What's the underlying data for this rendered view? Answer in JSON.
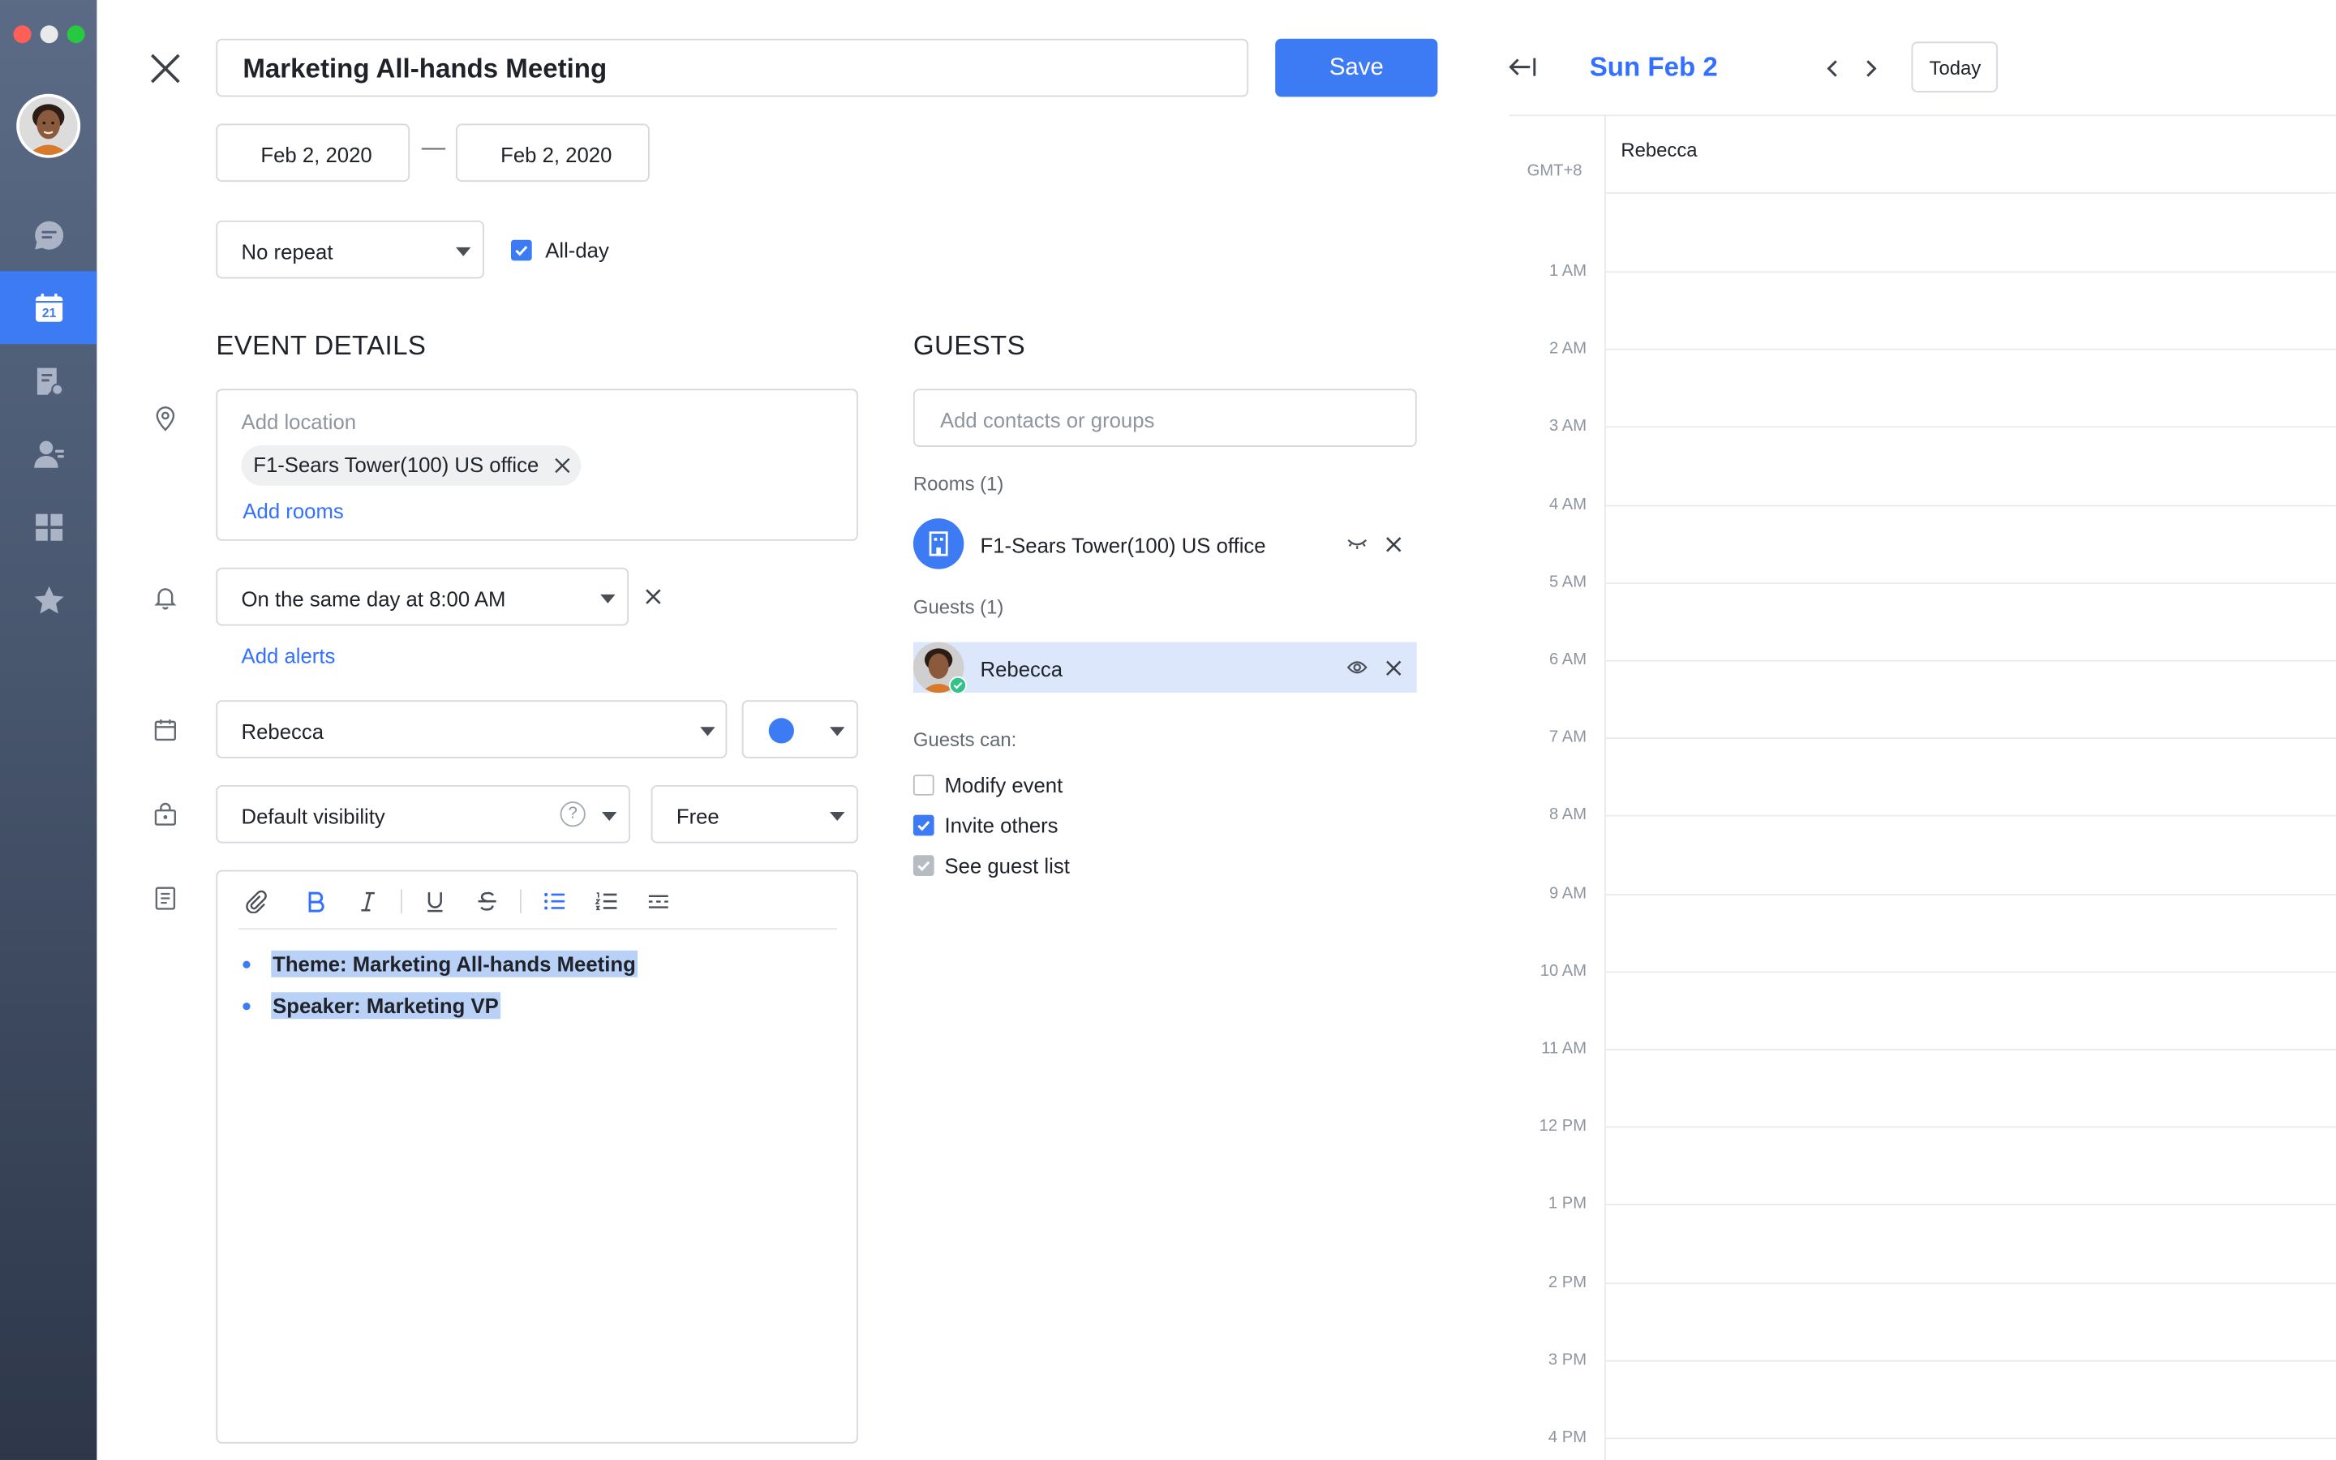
{
  "app": {
    "colors": {
      "accent": "#3d7bf4",
      "close": "#ff5f57",
      "minimize": "#febc2e",
      "zoom": "#28c840"
    },
    "sidebar": {
      "items": [
        {
          "icon": "chat-icon"
        },
        {
          "icon": "calendar-icon",
          "badge": "21",
          "active": true
        },
        {
          "icon": "docs-icon"
        },
        {
          "icon": "contacts-icon"
        },
        {
          "icon": "workplace-icon"
        },
        {
          "icon": "favorites-icon"
        }
      ]
    }
  },
  "event": {
    "title": "Marketing All-hands Meeting",
    "save_label": "Save",
    "start_date": "Feb 2, 2020",
    "date_separator": "—",
    "end_date": "Feb 2, 2020",
    "repeat": "No repeat",
    "all_day_label": "All-day",
    "all_day_checked": true
  },
  "details": {
    "section_title": "EVENT DETAILS",
    "location_placeholder": "Add location",
    "location_chip": "F1-Sears Tower(100) US office",
    "add_rooms": "Add rooms",
    "alert": "On the same day at 8:00 AM",
    "add_alerts": "Add alerts",
    "calendar": "Rebecca",
    "calendar_color": "#3d7bf4",
    "visibility": "Default visibility",
    "visibility_help": "?",
    "availability": "Free",
    "description": {
      "toolbar": [
        "attach-icon",
        "bold-icon",
        "italic-icon",
        "underline-icon",
        "strikethrough-icon",
        "bullet-list-icon",
        "numbered-list-icon",
        "divider-icon"
      ],
      "bullets": [
        "Theme: Marketing All-hands Meeting",
        "Speaker: Marketing VP"
      ]
    }
  },
  "guests": {
    "section_title": "GUESTS",
    "search_placeholder": "Add contacts or groups",
    "rooms_header": "Rooms (1)",
    "room_name": "F1-Sears Tower(100) US office",
    "guests_header": "Guests (1)",
    "guest_name": "Rebecca",
    "permissions_title": "Guests can:",
    "permissions": [
      {
        "label": "Modify event",
        "checked": false
      },
      {
        "label": "Invite others",
        "checked": true
      },
      {
        "label": "See guest list",
        "checked": true,
        "locked": true
      }
    ]
  },
  "calendar_view": {
    "date_title": "Sun Feb 2",
    "today_label": "Today",
    "timezone": "GMT+8",
    "column_owner": "Rebecca",
    "hours": [
      "1 AM",
      "2 AM",
      "3 AM",
      "4 AM",
      "5 AM",
      "6 AM",
      "7 AM",
      "8 AM",
      "9 AM",
      "10 AM",
      "11 AM",
      "12 PM",
      "1 PM",
      "2 PM",
      "3 PM",
      "4 PM"
    ]
  }
}
